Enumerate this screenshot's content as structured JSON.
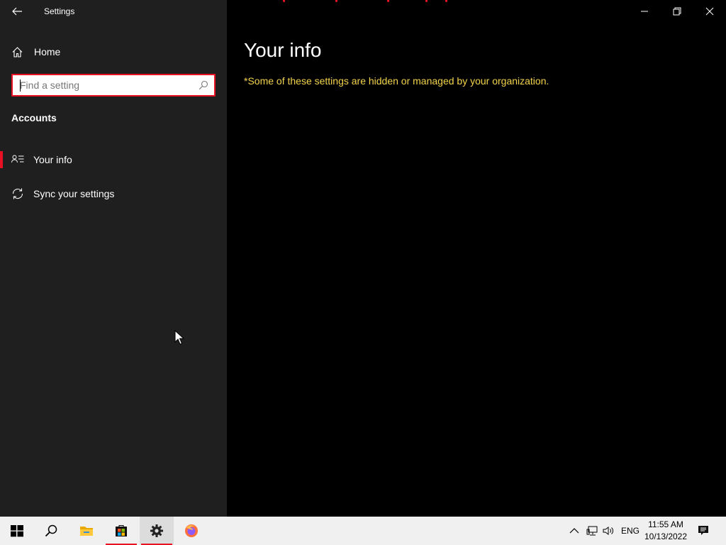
{
  "window": {
    "title": "Settings",
    "controls": {
      "minimize": "minimize-icon",
      "maximize": "restore-icon",
      "close": "close-icon"
    }
  },
  "sidebar": {
    "home_label": "Home",
    "search": {
      "placeholder": "Find a setting",
      "value": ""
    },
    "section_label": "Accounts",
    "items": [
      {
        "label": "Your info",
        "icon": "contact-info-icon",
        "selected": true
      },
      {
        "label": "Sync your settings",
        "icon": "sync-icon",
        "selected": false
      }
    ]
  },
  "main": {
    "title": "Your info",
    "org_note": "*Some of these settings are hidden or managed by your organization."
  },
  "taskbar": {
    "apps": [
      "start-icon",
      "search-icon",
      "file-explorer-icon",
      "store-icon",
      "settings-gear-icon",
      "firefox-icon"
    ],
    "tray": {
      "language": "ENG",
      "time": "11:55 AM",
      "date": "10/13/2022"
    }
  },
  "colors": {
    "accent": "#e81123",
    "sidebar_bg": "#1f1f1f",
    "main_bg": "#000000",
    "note_text": "#f2d34a",
    "taskbar_bg": "#f0f0f0"
  }
}
